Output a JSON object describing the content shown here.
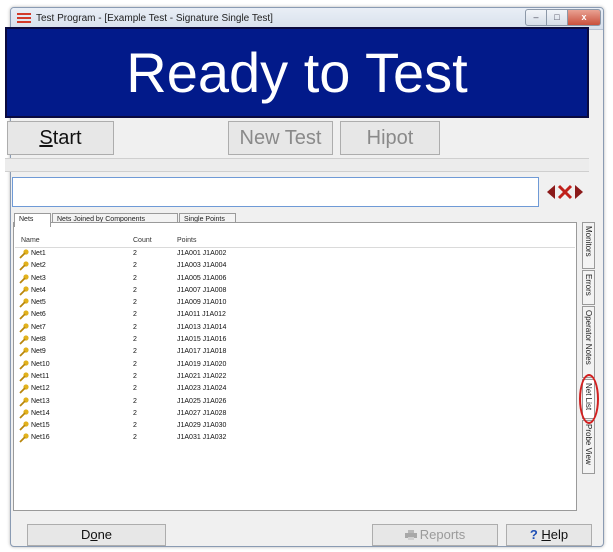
{
  "window": {
    "title": "Test Program - [Example Test - Signature Single Test]",
    "controls": {
      "minimize": "–",
      "maximize": "□",
      "close": "x"
    }
  },
  "banner": {
    "text": "Ready to Test",
    "background": "#021a8a",
    "color": "#ffffff"
  },
  "toolbar": {
    "start_prefix": "",
    "start_accel": "S",
    "start_suffix": "tart",
    "new_test": "New Test",
    "hipot": "Hipot"
  },
  "command": {
    "value": ""
  },
  "tabs": {
    "nets": "Nets",
    "joined": "Nets Joined by Components",
    "points": "Single Points"
  },
  "table": {
    "headers": {
      "name": "Name",
      "count": "Count",
      "points": "Points"
    },
    "rows": [
      {
        "name": "Net1",
        "count": "2",
        "points": "J1A001 J1A002"
      },
      {
        "name": "Net2",
        "count": "2",
        "points": "J1A003 J1A004"
      },
      {
        "name": "Net3",
        "count": "2",
        "points": "J1A005 J1A006"
      },
      {
        "name": "Net4",
        "count": "2",
        "points": "J1A007 J1A008"
      },
      {
        "name": "Net5",
        "count": "2",
        "points": "J1A009 J1A010"
      },
      {
        "name": "Net6",
        "count": "2",
        "points": "J1A011 J1A012"
      },
      {
        "name": "Net7",
        "count": "2",
        "points": "J1A013 J1A014"
      },
      {
        "name": "Net8",
        "count": "2",
        "points": "J1A015 J1A016"
      },
      {
        "name": "Net9",
        "count": "2",
        "points": "J1A017 J1A018"
      },
      {
        "name": "Net10",
        "count": "2",
        "points": "J1A019 J1A020"
      },
      {
        "name": "Net11",
        "count": "2",
        "points": "J1A021 J1A022"
      },
      {
        "name": "Net12",
        "count": "2",
        "points": "J1A023 J1A024"
      },
      {
        "name": "Net13",
        "count": "2",
        "points": "J1A025 J1A026"
      },
      {
        "name": "Net14",
        "count": "2",
        "points": "J1A027 J1A028"
      },
      {
        "name": "Net15",
        "count": "2",
        "points": "J1A029 J1A030"
      },
      {
        "name": "Net16",
        "count": "2",
        "points": "J1A031 J1A032"
      }
    ]
  },
  "side_tabs": {
    "monitors": "Monitors",
    "errors": "Errors",
    "operator_notes": "Operator Notes",
    "net_list": "Net List",
    "probe_view": "Probe View"
  },
  "bottom": {
    "done_prefix": "D",
    "done_accel": "o",
    "done_suffix": "ne",
    "reports": "Reports",
    "help_icon": "?",
    "help_accel": "H",
    "help_suffix": "elp"
  },
  "icons": {
    "app": "menu-lines-icon",
    "net": "net-key-icon",
    "nav": "left-right-x-icon",
    "reports": "printer-icon",
    "help": "question-icon"
  },
  "colors": {
    "highlight": "#d32020",
    "input_border": "#6f9ad6"
  }
}
